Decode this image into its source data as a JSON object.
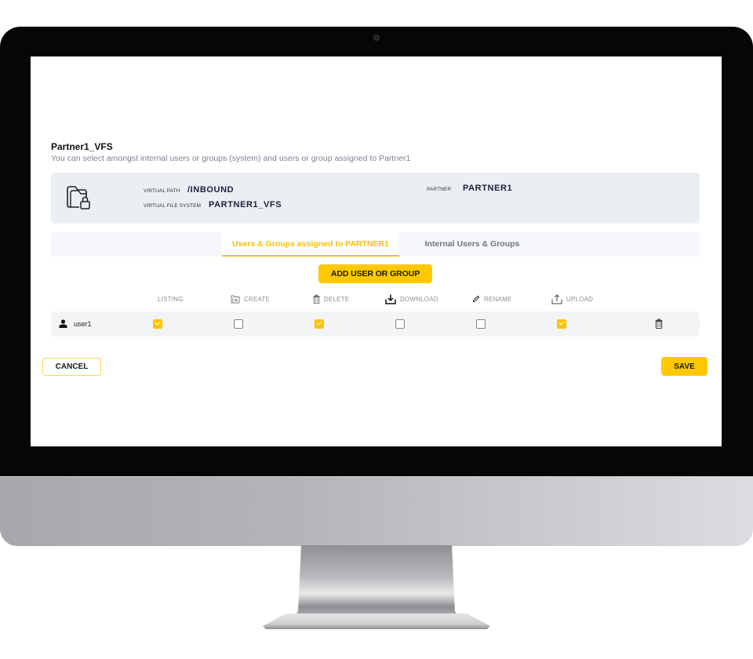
{
  "page": {
    "title": "Partner1_VFS",
    "subtitle": "You can select amongst internal users or groups (system) and users or group assigned to Partner1"
  },
  "info": {
    "icon": "folder-lock-icon",
    "virtual_path_label": "VIRTUAL PATH",
    "virtual_path": "/INBOUND",
    "vfs_label": "VIRTUAL FILE SYSTEM",
    "vfs": "PARTNER1_VFS",
    "partner_label": "PARTNER",
    "partner": "PARTNER1"
  },
  "tabs": [
    {
      "label": "Users & Groups assigned to PARTNER1",
      "active": true
    },
    {
      "label": "Internal Users & Groups",
      "active": false
    }
  ],
  "add_button": "ADD USER OR GROUP",
  "permissions": [
    {
      "label": "LISTING",
      "icon": null
    },
    {
      "label": "CREATE",
      "icon": "folder-plus-icon"
    },
    {
      "label": "DELETE",
      "icon": "trash-icon"
    },
    {
      "label": "DOWNLOAD",
      "icon": "download-icon"
    },
    {
      "label": "RENAME",
      "icon": "pencil-icon"
    },
    {
      "label": "UPLOAD",
      "icon": "upload-icon"
    }
  ],
  "rows": [
    {
      "icon": "person-icon",
      "name": "user1",
      "listing": true,
      "create": false,
      "delete": true,
      "download": false,
      "rename": false,
      "upload": true,
      "action_icon": "trash-icon"
    }
  ],
  "footer": {
    "cancel": "CANCEL",
    "save": "SAVE"
  },
  "colors": {
    "accent": "#ffc800",
    "card_bg": "#ebeef2",
    "value_text": "#1a1f3c"
  }
}
